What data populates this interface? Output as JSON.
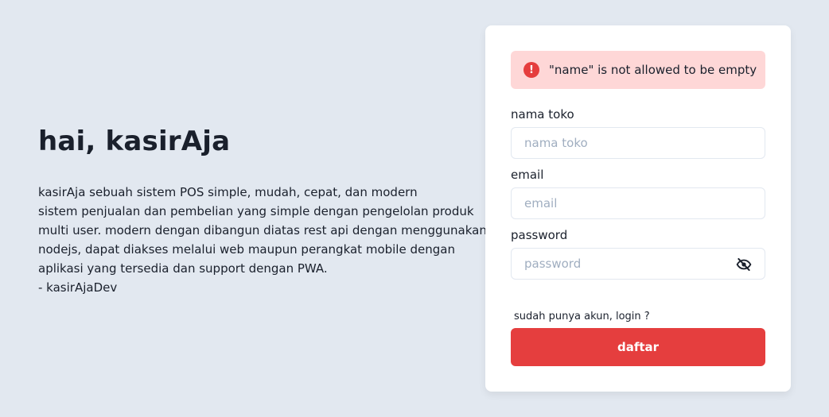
{
  "hero": {
    "title": "hai, kasirAja",
    "description_lines": [
      "kasirAja sebuah sistem POS simple, mudah, cepat, dan modern",
      "sistem penjualan dan pembelian yang simple dengan pengelolan produk",
      "multi user. modern dengan dibangun diatas rest api dengan menggunakan",
      "nodejs, dapat diakses melalui web maupun perangkat mobile dengan",
      "aplikasi yang tersedia dan support dengan PWA.",
      "- kasirAjaDev"
    ]
  },
  "alert": {
    "icon": "alert-circle-icon",
    "message": "\"name\" is not allowed to be empty",
    "color": "#e53e3e",
    "background": "#fed7d7"
  },
  "form": {
    "store_name": {
      "label": "nama toko",
      "placeholder": "nama toko",
      "value": ""
    },
    "email": {
      "label": "email",
      "placeholder": "email",
      "value": ""
    },
    "password": {
      "label": "password",
      "placeholder": "password",
      "value": "",
      "toggle_icon": "eye-off-icon"
    },
    "login_link": "sudah punya akun, login ?",
    "submit_label": "daftar",
    "submit_color": "#e53e3e"
  }
}
